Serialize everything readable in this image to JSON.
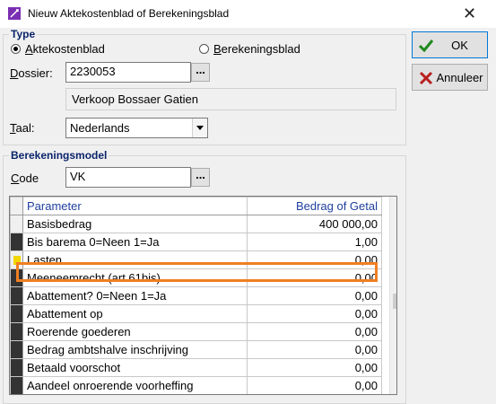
{
  "window": {
    "title": "Nieuw Aktekostenblad of Berekeningsblad",
    "close_glyph": "✕"
  },
  "type_group": {
    "legend": "Type",
    "radio_akte": "Aktekostenblad",
    "radio_akte_checked": true,
    "radio_ber": "Berekeningsblad",
    "radio_ber_checked": false
  },
  "dossier": {
    "label": "Dossier:",
    "value": "2230053",
    "browse": "...",
    "description": "Verkoop Bossaer Gatien"
  },
  "taal": {
    "label": "Taal:",
    "selected": "Nederlands"
  },
  "berekening_group": {
    "legend": "Berekeningsmodel",
    "code_label": "Code",
    "code_value": "VK",
    "browse": "..."
  },
  "buttons": {
    "ok": "OK",
    "cancel": "Annuleer"
  },
  "grid": {
    "columns": [
      "Parameter",
      "Bedrag of Getal"
    ],
    "rows": [
      {
        "parameter": "Basisbedrag",
        "value": "400 000,00"
      },
      {
        "parameter": "Bis barema 0=Neen 1=Ja",
        "value": "1,00"
      },
      {
        "parameter": "Lasten",
        "value": "0,00"
      },
      {
        "parameter": "Meeneemrecht (art.61bis)",
        "value": "0,00"
      },
      {
        "parameter": "Abattement? 0=Neen 1=Ja",
        "value": "0,00"
      },
      {
        "parameter": "Abattement op",
        "value": "0,00"
      },
      {
        "parameter": "Roerende goederen",
        "value": "0,00"
      },
      {
        "parameter": "Bedrag ambtshalve inschrijving",
        "value": "0,00"
      },
      {
        "parameter": "Betaald voorschot",
        "value": "0,00"
      },
      {
        "parameter": "Aandeel onroerende voorheffing",
        "value": "0,00"
      }
    ]
  },
  "colors": {
    "legend": "#0a246a",
    "header_text": "#1f3f9f",
    "highlight": "#f07f22",
    "ok_check": "#1e8a1e",
    "cancel_x": "#b81e1e"
  }
}
